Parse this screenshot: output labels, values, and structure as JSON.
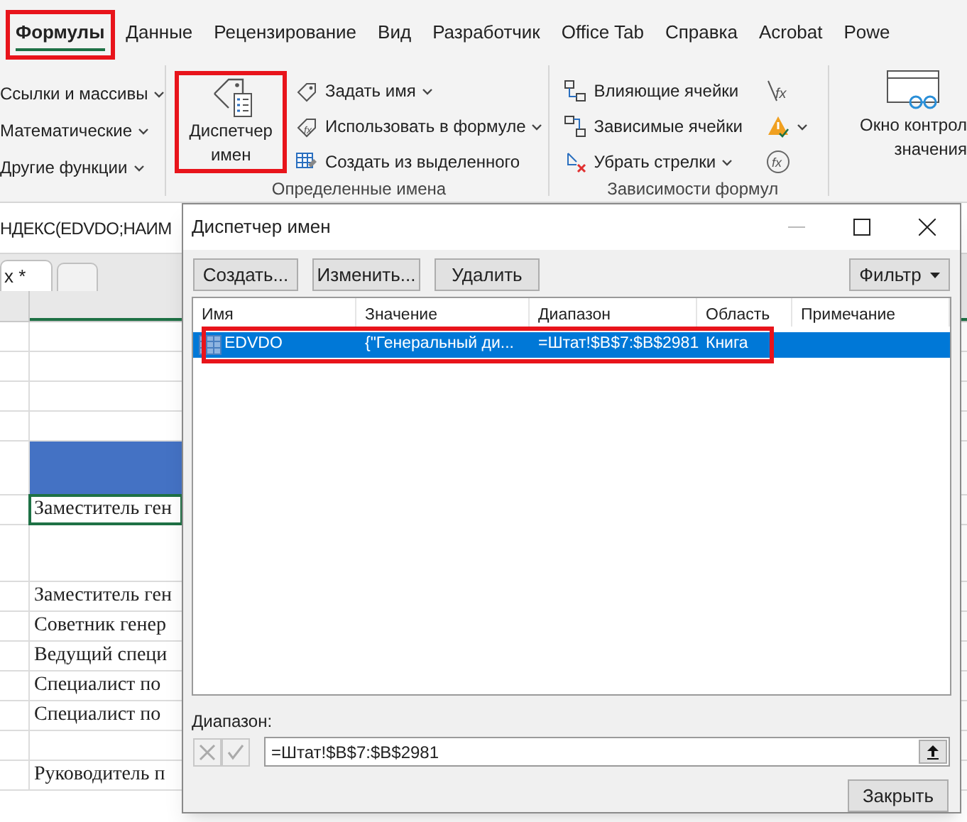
{
  "ribbon_tabs": [
    {
      "label": "Формулы",
      "selected": true,
      "highlighted": true
    },
    {
      "label": "Данные",
      "selected": false,
      "highlighted": false
    },
    {
      "label": "Рецензирование",
      "selected": false,
      "highlighted": false
    },
    {
      "label": "Вид",
      "selected": false,
      "highlighted": false
    },
    {
      "label": "Разработчик",
      "selected": false,
      "highlighted": false
    },
    {
      "label": "Office Tab",
      "selected": false,
      "highlighted": false
    },
    {
      "label": "Справка",
      "selected": false,
      "highlighted": false
    },
    {
      "label": "Acrobat",
      "selected": false,
      "highlighted": false
    },
    {
      "label": "Powe",
      "selected": false,
      "highlighted": false
    }
  ],
  "function_library": {
    "items": [
      {
        "label": "Ссылки и массивы"
      },
      {
        "label": "Математические"
      },
      {
        "label": "Другие функции"
      }
    ]
  },
  "defined_names": {
    "big_button": {
      "label": "Диспетчер имен",
      "highlighted": true
    },
    "items": [
      {
        "kind": "tag",
        "label": "Задать имя",
        "dropdown": true
      },
      {
        "kind": "fx",
        "label": "Использовать в формуле",
        "dropdown": true
      },
      {
        "kind": "table",
        "label": "Создать из выделенного",
        "dropdown": false
      }
    ],
    "label": "Определенные имена"
  },
  "formula_auditing": {
    "items": [
      {
        "kind": "precedents",
        "label": "Влияющие ячейки",
        "dropdown": false
      },
      {
        "kind": "dependents",
        "label": "Зависимые ячейки",
        "dropdown": false
      },
      {
        "kind": "remove",
        "label": "Убрать стрелки",
        "dropdown": true
      }
    ],
    "label": "Зависимости формул"
  },
  "auditing_buttons": [
    {
      "kind": "show_formulas",
      "glyph": "fx",
      "dropdown": false
    },
    {
      "kind": "error_check",
      "dropdown": true
    },
    {
      "kind": "evaluate",
      "glyph": "fx",
      "dropdown": false
    }
  ],
  "watch_window": {
    "lines": [
      "Окно контрол",
      "значения"
    ]
  },
  "formula_bar": {
    "value": "НДЕКС(EDVDO;НАИМ"
  },
  "sheet_tabs": [
    {
      "label": "x *",
      "selected": true
    },
    {
      "selected": false
    }
  ],
  "sheet_rows": [
    {
      "kind": "empty"
    },
    {
      "kind": "empty"
    },
    {
      "kind": "empty"
    },
    {
      "kind": "empty"
    },
    {
      "kind": "band"
    },
    {
      "kind": "cell",
      "text": "Заместитель ген",
      "selected": true
    },
    {
      "kind": "tall"
    },
    {
      "kind": "cell",
      "text": "Заместитель ген",
      "selected": false
    },
    {
      "kind": "cell",
      "text": "Советник генер",
      "selected": false
    },
    {
      "kind": "cell",
      "text": "Ведущий специ",
      "selected": false
    },
    {
      "kind": "cell",
      "text": "Специалист по",
      "selected": false
    },
    {
      "kind": "cell",
      "text": "Специалист по",
      "selected": false
    },
    {
      "kind": "empty"
    },
    {
      "kind": "cell",
      "text": "Руководитель п",
      "selected": false
    }
  ],
  "dialog": {
    "title": "Диспетчер имен",
    "buttons": [
      "Создать...",
      "Изменить...",
      "Удалить"
    ],
    "filter_button": "Фильтр",
    "columns": [
      "Имя",
      "Значение",
      "Диапазон",
      "Область",
      "Примечание"
    ],
    "rows": [
      {
        "name": "EDVDO",
        "value": "{\"Генеральный ди...",
        "range": "=Штат!$B$7:$B$2981",
        "scope": "Книга",
        "selected": true,
        "highlighted": true
      }
    ],
    "range_label": "Диапазон:",
    "range_value": "=Штат!$B$7:$B$2981",
    "close_button": "Закрыть"
  }
}
